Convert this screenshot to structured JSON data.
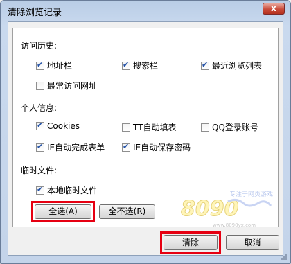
{
  "window": {
    "title": "清除浏览记录",
    "close_glyph": "x"
  },
  "history": {
    "heading": "访问历史:",
    "items": [
      {
        "label": "地址栏",
        "checked": true
      },
      {
        "label": "搜索栏",
        "checked": true
      },
      {
        "label": "最近浏览列表",
        "checked": true
      },
      {
        "label": "最常访问网址",
        "checked": false
      }
    ]
  },
  "personal": {
    "heading": "个人信息:",
    "items": [
      {
        "label": "Cookies",
        "checked": true
      },
      {
        "label": "TT自动填表",
        "checked": false
      },
      {
        "label": "QQ登录账号",
        "checked": false
      },
      {
        "label": "IE自动完成表单",
        "checked": true
      },
      {
        "label": "IE自动保存密码",
        "checked": true
      }
    ]
  },
  "temp": {
    "heading": "临时文件:",
    "items": [
      {
        "label": "本地临时文件",
        "checked": true
      }
    ]
  },
  "buttons": {
    "select_all": "全选(A)",
    "select_none": "全不选(R)",
    "clear": "清除",
    "cancel": "取消"
  },
  "watermark": {
    "text": "8090",
    "tagline": "专注于网页游戏",
    "url": "www.8090yx.com"
  },
  "colors": {
    "highlight": "#e60012",
    "check": "#1f4fa6"
  }
}
